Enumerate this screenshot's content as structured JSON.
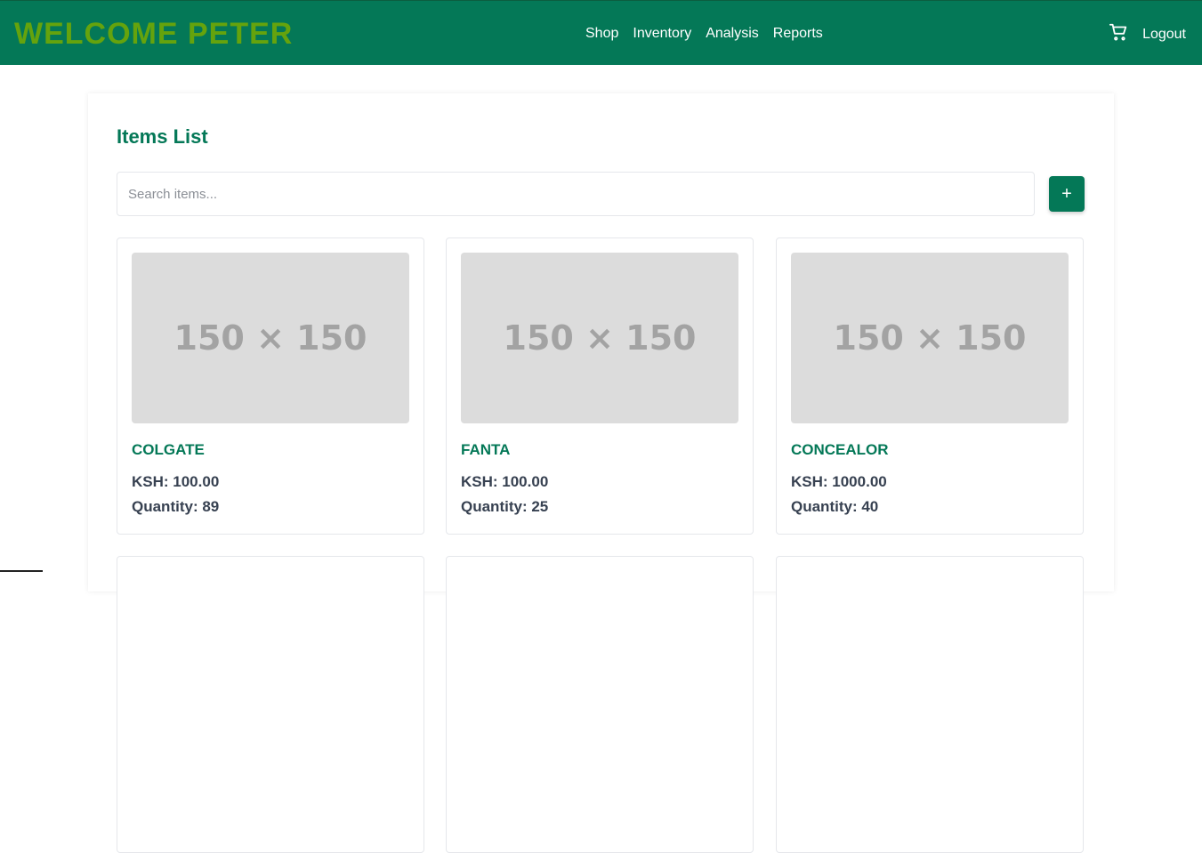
{
  "header": {
    "brand": "WELCOME PETER",
    "nav": [
      "Shop",
      "Inventory",
      "Analysis",
      "Reports"
    ],
    "cart_icon": "cart-icon",
    "logout_label": "Logout"
  },
  "main": {
    "title": "Items List",
    "search": {
      "placeholder": "Search items...",
      "value": ""
    },
    "add_button_label": "+",
    "items": [
      {
        "image_label": "150 × 150",
        "name": "COLGATE",
        "price": "KSH: 100.00",
        "quantity": "Quantity: 89"
      },
      {
        "image_label": "150 × 150",
        "name": "FANTA",
        "price": "KSH: 100.00",
        "quantity": "Quantity: 25"
      },
      {
        "image_label": "150 × 150",
        "name": "CONCEALOR",
        "price": "KSH: 1000.00",
        "quantity": "Quantity: 40"
      }
    ]
  },
  "colors": {
    "primary": "#047857",
    "brand_text": "#65a30d",
    "placeholder_bg": "#dcdcdc"
  }
}
